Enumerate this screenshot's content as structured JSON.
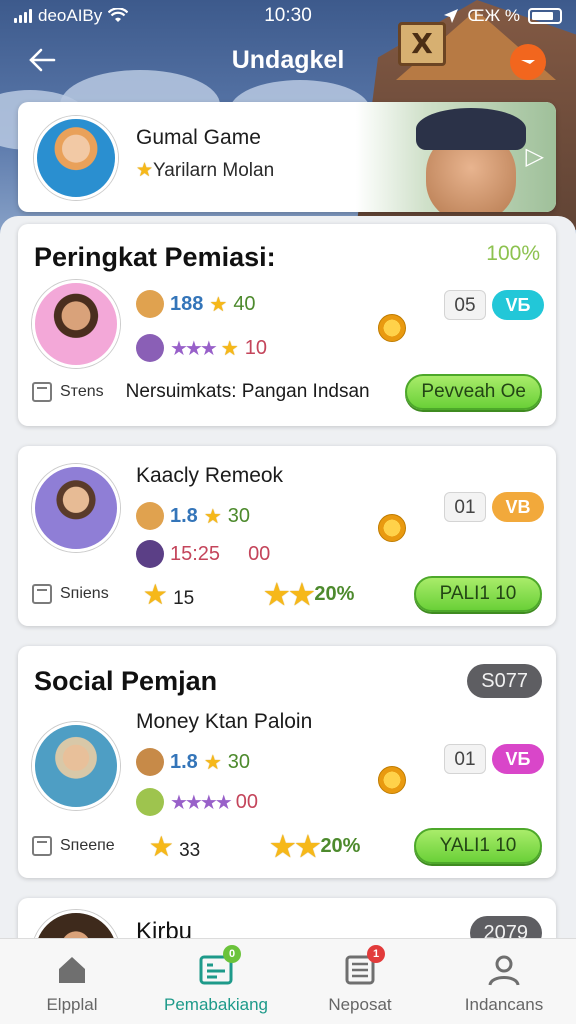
{
  "status": {
    "carrier": "deoAIBy",
    "time": "10:30",
    "battery_text": "ŒЖ %"
  },
  "header": {
    "title": "Undagkel"
  },
  "profile": {
    "name": "Gumal Game",
    "subtitle": "Yarilarn Molan"
  },
  "cards": [
    {
      "heading": "Peringkat Pemiasi:",
      "percent": "100%",
      "stat1_value": "188",
      "stat1_score": "40",
      "stat2_value": "10",
      "number": "05",
      "pill": "VБ",
      "pill_color": "#22c7d8",
      "footer_label": "Sтеns",
      "footer_text": "Nersuimkats: Pangan  Indsan",
      "button": "Pevveah Oe"
    },
    {
      "title": "Kaacly Remeok",
      "stat1_value": "1.8",
      "stat1_score": "30",
      "stat2_time": "15:25",
      "stat2_value": "00",
      "number": "01",
      "pill": "VB",
      "pill_color": "#f2a93b",
      "footer_label": "Sпіens",
      "footer_stars": "15",
      "footer_pct": "20%",
      "button": "PALI1 10"
    },
    {
      "heading": "Social Pemjan",
      "badge": "S077",
      "title": "Money Ktan Paloin",
      "stat1_value": "1.8",
      "stat1_score": "30",
      "stat2_value": "00",
      "number": "01",
      "pill": "VБ",
      "pill_color": "#d946c9",
      "footer_label": "Sпеепе",
      "footer_stars": "33",
      "footer_pct": "20%",
      "button": "YALI1 10"
    },
    {
      "heading": "Kirbu",
      "badge": "2079"
    }
  ],
  "tabs": [
    {
      "label": "Elpplal",
      "icon": "home-icon"
    },
    {
      "label": "Pemabakiang",
      "icon": "leaderboard-icon",
      "badge": "0",
      "badge_color": "#6bc33b"
    },
    {
      "label": "Neposat",
      "icon": "news-icon",
      "badge": "1",
      "badge_color": "#e23b3b"
    },
    {
      "label": "Indancans",
      "icon": "profile-icon"
    }
  ]
}
